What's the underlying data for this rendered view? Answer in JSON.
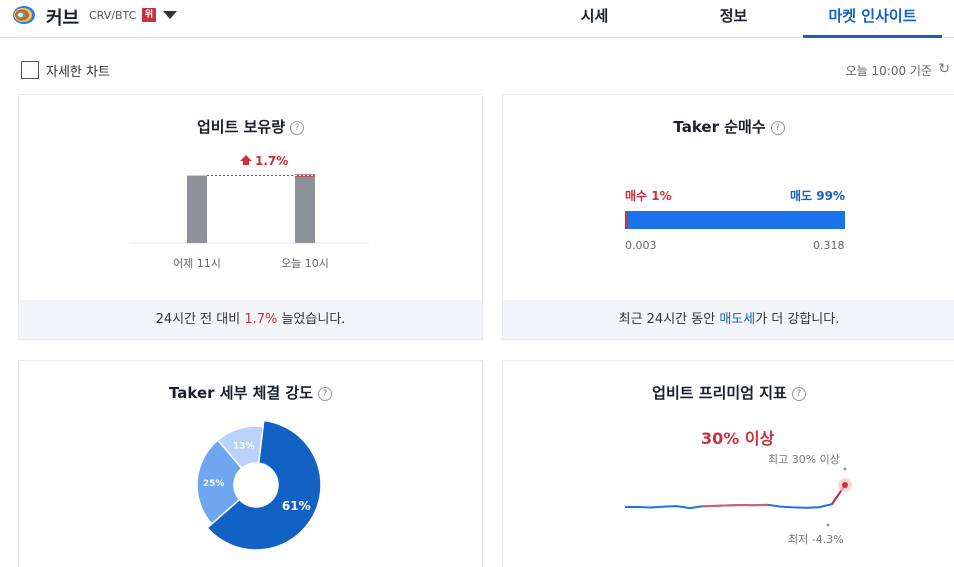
{
  "header": {
    "coin_name": "커브",
    "pair": "CRV/BTC",
    "warning_badge": "위",
    "tabs": [
      "시세",
      "정보",
      "마켓 인사이트"
    ],
    "active_tab": 2,
    "colors": {
      "accent": "#1261c4",
      "up": "#c8313e",
      "down": "#1261c4"
    }
  },
  "options": {
    "detail_chart_label": "자세한 차트",
    "detail_chart_checked": false,
    "basis_time": "오늘 10:00 기준"
  },
  "upbit_holdings": {
    "title": "업비트 보유량",
    "change_label": "1.7%",
    "change_direction": "up",
    "chart_data": {
      "type": "bar",
      "categories": [
        "어제 11시",
        "오늘 10시"
      ],
      "values": [
        100,
        101.7
      ]
    },
    "footer": {
      "prefix": "24시간 전 대비 ",
      "value": "1.7%",
      "suffix": " 늘었습니다."
    }
  },
  "taker_ratio": {
    "title": "Taker 순매수",
    "buy_label": "매수 1%",
    "sell_label": "매도 99%",
    "buy_fraction": 0.01,
    "buy_amount": "0.003",
    "sell_amount": "0.318",
    "footer": {
      "prefix": "최근 24시간 동안 ",
      "value": "매도세",
      "suffix": "가 더 강합니다."
    }
  },
  "taker_strength": {
    "title": "Taker 세부 체결 강도",
    "chart_data": {
      "type": "pie",
      "categories": [
        "61%",
        "25%",
        "13%"
      ],
      "values": [
        61,
        25,
        13
      ],
      "colors": [
        "#1261c4",
        "#6ea6f0",
        "#b8d3f7"
      ]
    }
  },
  "premium": {
    "title": "업비트 프리미엄 지표",
    "value_label": "30% 이상",
    "high_label": "최고 30% 이상",
    "low_label": "최저 -4.3%",
    "chart_data": {
      "type": "line",
      "values": [
        0,
        0,
        -0.3,
        0.2,
        0.5,
        -0.6,
        0.4,
        0.6,
        0.9,
        1.1,
        1.0,
        1.2,
        0.2,
        -0.2,
        -0.4,
        -0.1,
        1.6,
        30
      ]
    }
  }
}
